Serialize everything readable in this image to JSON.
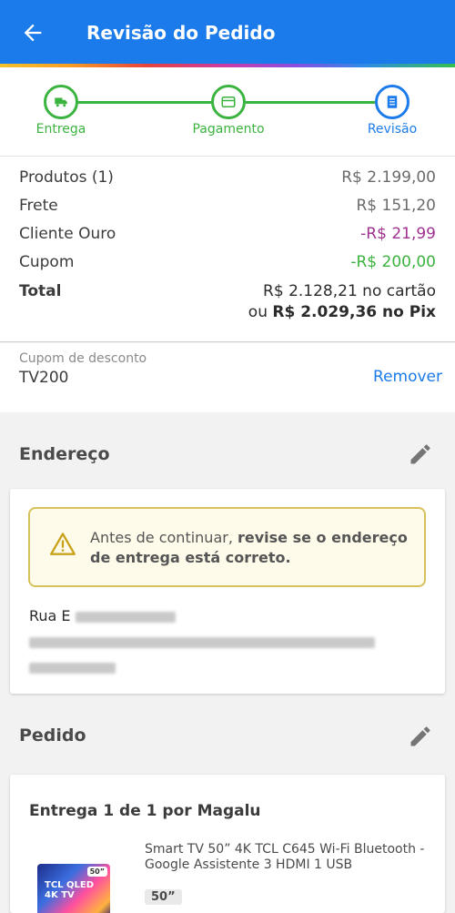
{
  "header": {
    "title": "Revisão do Pedido"
  },
  "steps": [
    {
      "label": "Entrega",
      "icon": "truck-icon"
    },
    {
      "label": "Pagamento",
      "icon": "card-icon"
    },
    {
      "label": "Revisão",
      "icon": "document-icon"
    }
  ],
  "summary": {
    "products_label": "Produtos (1)",
    "products_value": "R$ 2.199,00",
    "shipping_label": "Frete",
    "shipping_value": "R$ 151,20",
    "gold_label": "Cliente Ouro",
    "gold_value": "-R$ 21,99",
    "coupon_label": "Cupom",
    "coupon_value": "-R$ 200,00",
    "total_label": "Total",
    "total_card": "R$ 2.128,21 no cartão",
    "total_pix_prefix": "ou ",
    "total_pix": "R$ 2.029,36 no Pix"
  },
  "coupon": {
    "label": "Cupom de desconto",
    "value": "TV200",
    "remove": "Remover"
  },
  "address": {
    "section_title": "Endereço",
    "warning_prefix": "Antes de continuar, ",
    "warning_bold": "revise se o endereço de entrega está correto.",
    "street_prefix": "Rua E"
  },
  "order": {
    "section_title": "Pedido",
    "delivery_heading": "Entrega 1 de 1 por Magalu",
    "product_title": "Smart TV 50” 4K TCL C645 Wi-Fi Bluetooth - Google Assistente 3 HDMI 1 USB",
    "product_size": "50”",
    "thumb_text": "TCL QLED 4K TV",
    "thumb_badge": "50”"
  },
  "colors": {
    "primary": "#1c7bea",
    "success": "#3bb33f",
    "purple": "#a0318f",
    "warning_border": "#d7c15a"
  }
}
